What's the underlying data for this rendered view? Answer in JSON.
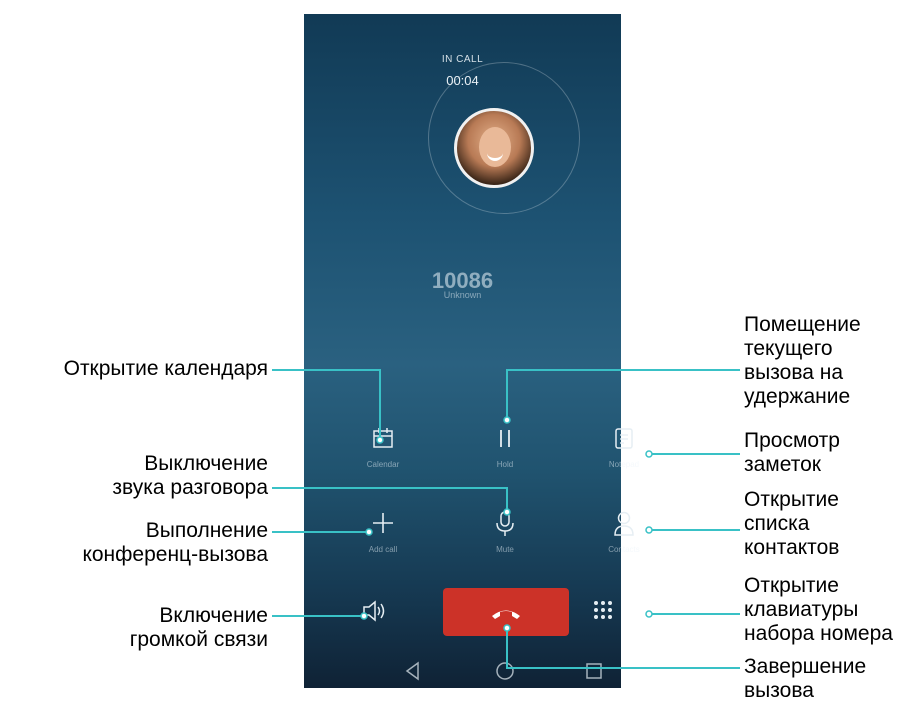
{
  "phone": {
    "status": "IN CALL",
    "timer": "00:04",
    "number": "10086",
    "number_label": "Unknown",
    "controls": {
      "calendar": "Calendar",
      "hold": "Hold",
      "notepad": "Notepad",
      "add_call": "Add call",
      "mute": "Mute",
      "contacts": "Contacts"
    },
    "colors": {
      "end_call": "#cc3228",
      "callout_line": "#39c1c6"
    }
  },
  "callouts": {
    "calendar": "Открытие календаря",
    "mute": [
      "Выключение",
      "звука разговора"
    ],
    "add_call": [
      "Выполнение",
      "конференц-вызова"
    ],
    "speaker": [
      "Включение",
      "громкой связи"
    ],
    "hold": [
      "Помещение",
      "текущего",
      "вызова на",
      "удержание"
    ],
    "notepad": [
      "Просмотр",
      "заметок"
    ],
    "contacts": [
      "Открытие",
      "списка",
      "контактов"
    ],
    "dialpad": [
      "Открытие",
      "клавиатуры",
      "набора номера"
    ],
    "end_call": [
      "Завершение",
      "вызова"
    ]
  }
}
